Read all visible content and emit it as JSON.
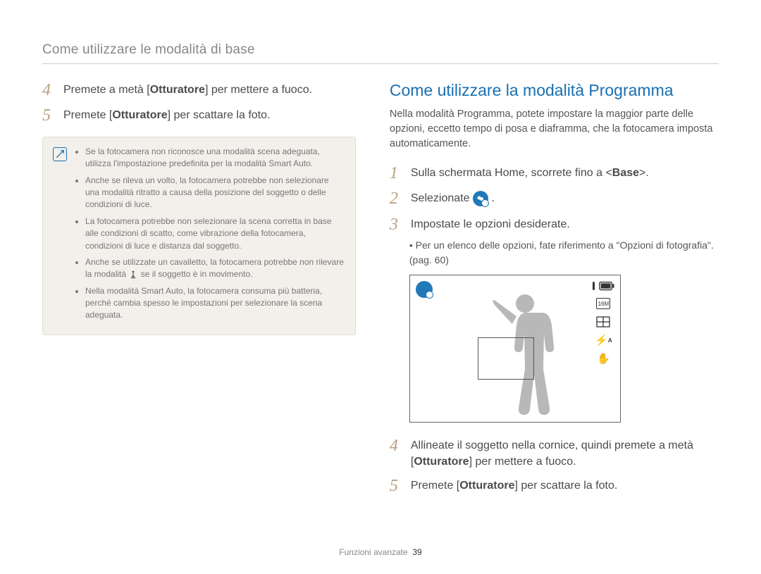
{
  "header": {
    "section_title": "Come utilizzare le modalità di base"
  },
  "left": {
    "step4_num": "4",
    "step4_pre": "Premete a metà [",
    "step4_bold": "Otturatore",
    "step4_post": "] per mettere a fuoco.",
    "step5_num": "5",
    "step5_pre": "Premete [",
    "step5_bold": "Otturatore",
    "step5_post": "] per scattare la foto.",
    "notes": {
      "n1": "Se la fotocamera non riconosce una modalità scena adeguata, utilizza l'impostazione predefinita per la modalità Smart Auto.",
      "n2": "Anche se rileva un volto, la fotocamera potrebbe non selezionare una modalità ritratto a causa della posizione del soggetto o delle condizioni di luce.",
      "n3": "La fotocamera potrebbe non selezionare la scena corretta in base alle condizioni di scatto, come vibrazione della fotocamera, condizioni di luce e distanza dal soggetto.",
      "n4_pre": "Anche se utilizzate un cavalletto, la fotocamera potrebbe non rilevare la modalità ",
      "n4_post": " se il soggetto è in movimento.",
      "n5": "Nella modalità Smart Auto, la fotocamera consuma più batteria, perché cambia spesso le impostazioni per selezionare la scena adeguata."
    }
  },
  "right": {
    "heading": "Come utilizzare la modalità Programma",
    "intro": "Nella modalità Programma, potete impostare la maggior parte delle opzioni, eccetto tempo di posa e diaframma, che la fotocamera imposta automaticamente.",
    "step1_num": "1",
    "step1_pre": "Sulla schermata Home, scorrete fino a <",
    "step1_bold": "Base",
    "step1_post": ">.",
    "step2_num": "2",
    "step2_text": "Selezionate ",
    "step2_period": ".",
    "step3_num": "3",
    "step3_text": "Impostate le opzioni desiderate.",
    "step3_sub": "Per un elenco delle opzioni, fate riferimento a \"Opzioni di fotografia\". (pag. 60)",
    "step4_num": "4",
    "step4_pre": "Allineate il soggetto nella cornice, quindi premete a metà [",
    "step4_bold": "Otturatore",
    "step4_post": "] per mettere a fuoco.",
    "step5_num": "5",
    "step5_pre": "Premete [",
    "step5_bold": "Otturatore",
    "step5_post": "] per scattare la foto."
  },
  "lcd": {
    "icon_16m": "16M"
  },
  "footer": {
    "label": "Funzioni avanzate",
    "page": "39"
  }
}
